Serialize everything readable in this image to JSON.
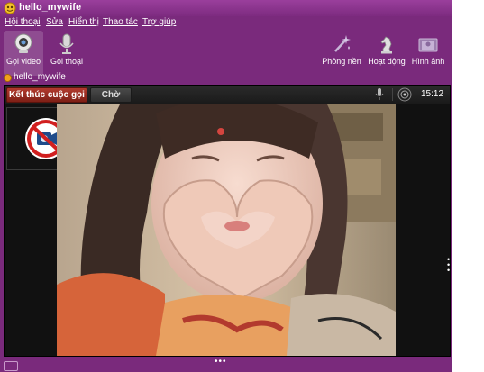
{
  "window": {
    "title": "hello_mywife"
  },
  "menu": [
    "Hội thoại",
    "Sửa",
    "Hiển thị",
    "Thao tác",
    "Trợ giúp"
  ],
  "toolbar": {
    "video_call": "Gọi video",
    "voice_call": "Gọi thoại",
    "background": "Phông nền",
    "activity": "Hoạt động",
    "images": "Hình ảnh"
  },
  "contact": {
    "name": "hello_mywife"
  },
  "call": {
    "end_label": "Kết thúc cuộc gọi",
    "hold_label": "Chờ",
    "timer": "15:12"
  },
  "colors": {
    "theme": "#7a2a7c",
    "end_button": "#9a2e23"
  },
  "icons": [
    "app-icon",
    "webcam-icon",
    "microphone-icon",
    "wand-icon",
    "chess-knight-icon",
    "photos-icon",
    "status-icon",
    "mic-indicator-icon",
    "volume-icon",
    "camera-off-icon"
  ]
}
